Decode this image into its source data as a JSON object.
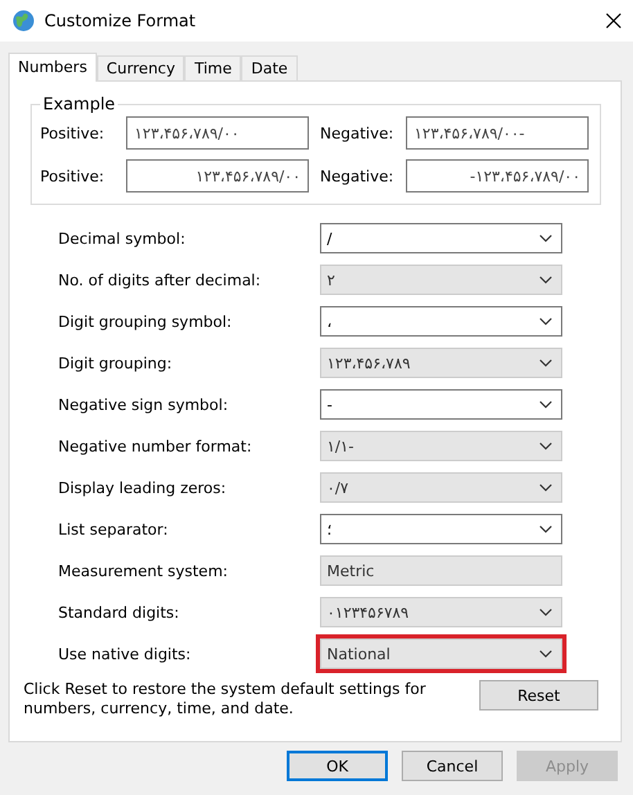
{
  "window": {
    "title": "Customize Format"
  },
  "tabs": [
    {
      "label": "Numbers",
      "selected": true
    },
    {
      "label": "Currency",
      "selected": false
    },
    {
      "label": "Time",
      "selected": false
    },
    {
      "label": "Date",
      "selected": false
    }
  ],
  "example": {
    "title": "Example",
    "rows": [
      {
        "positive_label": "Positive:",
        "positive": "۱۲۳،۴۵۶،۷۸۹/۰۰",
        "negative_label": "Negative:",
        "negative": "۱۲۳،۴۵۶،۷۸۹/۰۰-"
      },
      {
        "positive_label": "Positive:",
        "positive": "۱۲۳،۴۵۶،۷۸۹/۰۰",
        "negative_label": "Negative:",
        "negative": "-۱۲۳،۴۵۶،۷۸۹/۰۰"
      }
    ]
  },
  "settings": [
    {
      "label": "Decimal symbol:",
      "value": "/",
      "kind": "dropdown",
      "disabled": false,
      "highlighted": false
    },
    {
      "label": "No. of digits after decimal:",
      "value": "۲",
      "kind": "dropdown",
      "disabled": true,
      "highlighted": false
    },
    {
      "label": "Digit grouping symbol:",
      "value": "،",
      "kind": "dropdown",
      "disabled": false,
      "highlighted": false
    },
    {
      "label": "Digit grouping:",
      "value": "۱۲۳،۴۵۶،۷۸۹",
      "kind": "dropdown",
      "disabled": true,
      "highlighted": false
    },
    {
      "label": "Negative sign symbol:",
      "value": "-",
      "kind": "dropdown",
      "disabled": false,
      "highlighted": false
    },
    {
      "label": "Negative number format:",
      "value": "۱/۱-",
      "kind": "dropdown",
      "disabled": true,
      "highlighted": false
    },
    {
      "label": "Display leading zeros:",
      "value": "۰/۷",
      "kind": "dropdown",
      "disabled": true,
      "highlighted": false
    },
    {
      "label": "List separator:",
      "value": "؛",
      "kind": "dropdown",
      "disabled": false,
      "highlighted": false
    },
    {
      "label": "Measurement system:",
      "value": "Metric",
      "kind": "readonly",
      "disabled": true,
      "highlighted": false
    },
    {
      "label": "Standard digits:",
      "value": "۰۱۲۳۴۵۶۷۸۹",
      "kind": "dropdown",
      "disabled": true,
      "highlighted": false
    },
    {
      "label": "Use native digits:",
      "value": "National",
      "kind": "dropdown",
      "disabled": true,
      "highlighted": true
    }
  ],
  "reset_note": "Click Reset to restore the system default settings for numbers, currency, time, and date.",
  "reset_button": "Reset",
  "buttons": [
    {
      "label": "OK",
      "default": true,
      "disabled": false
    },
    {
      "label": "Cancel",
      "default": false,
      "disabled": false
    },
    {
      "label": "Apply",
      "default": false,
      "disabled": true
    }
  ]
}
